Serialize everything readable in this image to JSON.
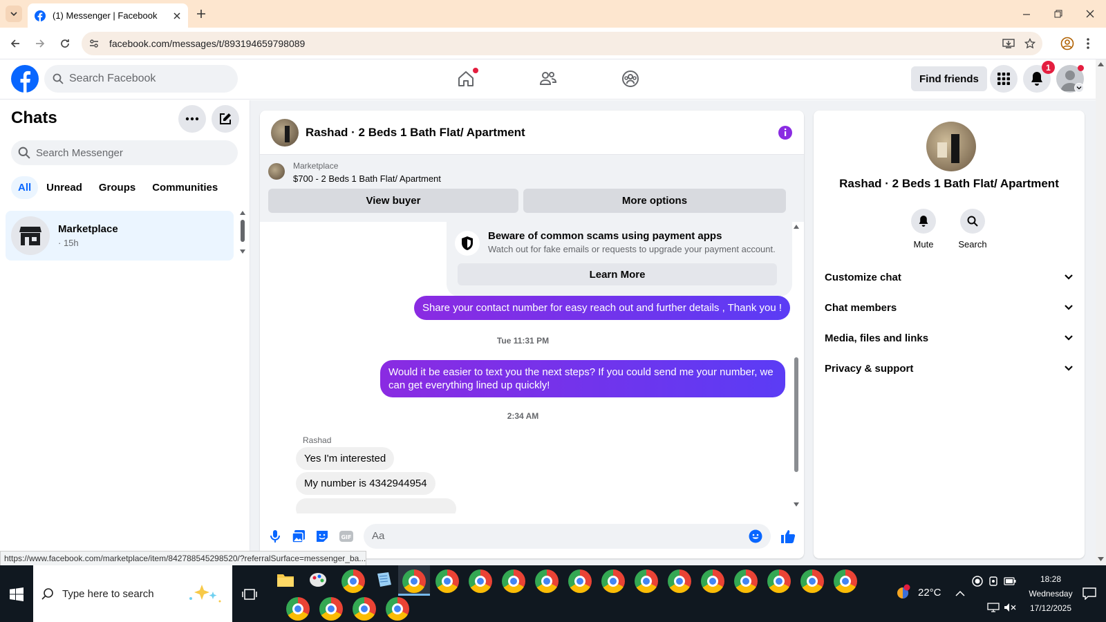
{
  "browser": {
    "tab_title": "(1) Messenger | Facebook",
    "url": "facebook.com/messages/t/893194659798089",
    "status_url": "https://www.facebook.com/marketplace/item/842788545298520/?referralSurface=messenger_ba..."
  },
  "fb": {
    "search_placeholder": "Search Facebook",
    "find_friends": "Find friends",
    "notif_count": "1"
  },
  "sidebar": {
    "title": "Chats",
    "search_placeholder": "Search Messenger",
    "filters": [
      "All",
      "Unread",
      "Groups",
      "Communities"
    ],
    "chat": {
      "name": "Marketplace",
      "time": "· 15h"
    }
  },
  "chat": {
    "header_title": "Rashad · 2 Beds 1 Bath Flat/ Apartment",
    "listing_source": "Marketplace",
    "listing_title": "$700 - 2 Beds 1 Bath Flat/ Apartment",
    "view_buyer": "View buyer",
    "more_options": "More options",
    "scam_title": "Beware of common scams using payment apps",
    "scam_body": "Watch out for fake emails or requests to upgrade your payment account.",
    "learn_more": "Learn More",
    "msg1": "Share your contact number for easy reach out and further details , Thank you !",
    "ts1": "Tue 11:31 PM",
    "msg2": "Would it be easier to text you the next steps? If you could send me your number, we can get everything lined up quickly!",
    "ts2": "2:34 AM",
    "sender": "Rashad",
    "in1": "Yes I'm interested",
    "in2": "My number is 4342944954",
    "composer_placeholder": "Aa"
  },
  "info": {
    "name": "Rashad · 2 Beds 1 Bath Flat/ Apartment",
    "mute": "Mute",
    "search": "Search",
    "rows": [
      "Customize chat",
      "Chat members",
      "Media, files and links",
      "Privacy & support"
    ]
  },
  "taskbar": {
    "search_placeholder": "Type here to search",
    "weather": "22°C",
    "time": "18:28",
    "day": "Wednesday",
    "date": "17/12/2025"
  },
  "colors": {
    "accent": "#0866ff",
    "bubble": "#7b2ff7",
    "fb_blue": "#0866ff"
  }
}
